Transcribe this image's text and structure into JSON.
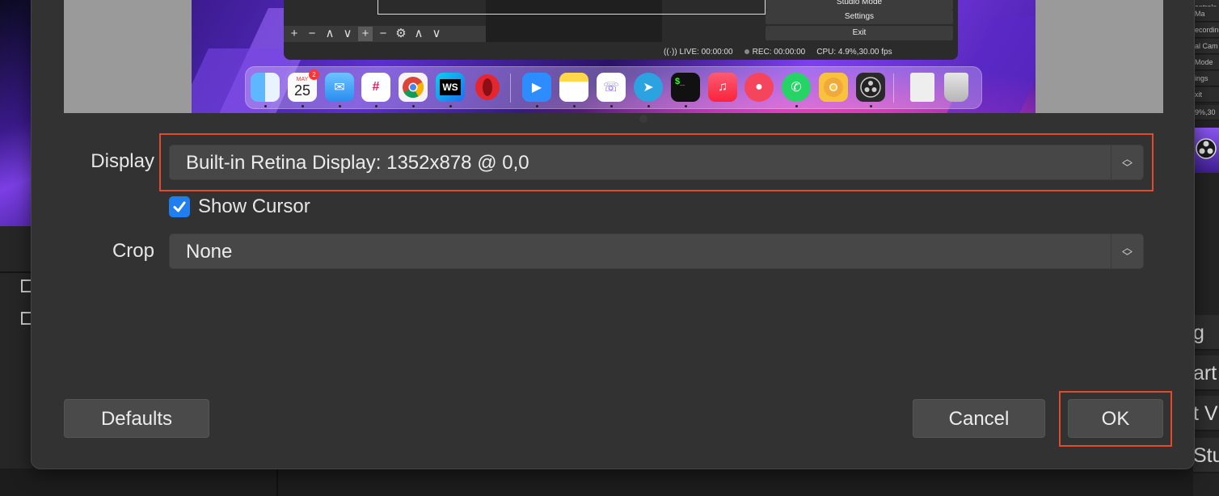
{
  "dialog": {
    "fields": {
      "display": {
        "label": "Display",
        "value": "Built-in Retina Display: 1352x878 @ 0,0"
      },
      "show_cursor": {
        "label": "Show Cursor",
        "checked": true
      },
      "crop": {
        "label": "Crop",
        "value": "None"
      }
    },
    "buttons": {
      "defaults": "Defaults",
      "cancel": "Cancel",
      "ok": "OK"
    },
    "highlight_color": "#e24a2c",
    "checkbox_color": "#1f7ff0"
  },
  "preview": {
    "obs_buttons": [
      "Studio Mode",
      "Settings",
      "Exit"
    ],
    "obs_status": {
      "live": "LIVE: 00:00:00",
      "rec": "REC: 00:00:00",
      "cpu": "CPU: 4.9%,30.00 fps"
    },
    "toolbar_symbols": [
      "+",
      "−",
      "∧",
      "∨",
      "+",
      "−",
      "⚙",
      "∧",
      "∨"
    ],
    "calendar": {
      "month": "MAY",
      "day": "25",
      "badge": "2"
    },
    "dock_apps": [
      "finder-icon",
      "calendar-icon",
      "mail-icon",
      "slack-icon",
      "chrome-icon",
      "webstorm-icon",
      "opera-icon",
      "zoom-icon",
      "notes-icon",
      "viber-icon",
      "telegram-icon",
      "terminal-icon",
      "music-icon",
      "rocketchat-icon",
      "whatsapp-icon",
      "chrome-canary-icon",
      "obs-icon",
      "documents-icon",
      "trash-icon"
    ]
  },
  "background": {
    "right_menu": [
      "ontrols",
      "Ma",
      "ecording",
      "al Cam",
      "Mode",
      "ings",
      "xit",
      "9%,30"
    ],
    "right_buttons": [
      "g",
      "art",
      "t V",
      "Stu"
    ]
  }
}
